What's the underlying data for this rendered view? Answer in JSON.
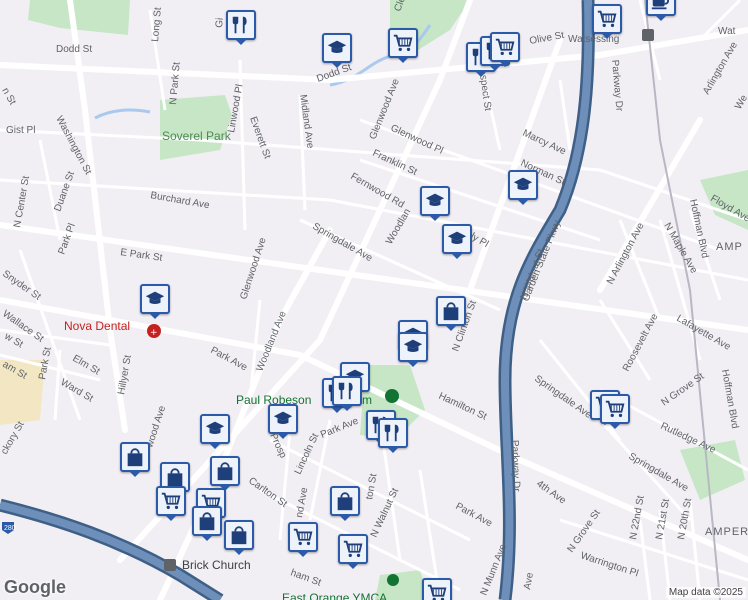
{
  "map": {
    "attribution": "Map data ©2025",
    "logo": "Google",
    "colors": {
      "land": "#f2eff4",
      "park": "#c6e6c6",
      "water": "#a9c9ee",
      "highway": "#5e7fa8",
      "highway_edge": "#3e5f86",
      "road": "#ffffff",
      "pin_border": "#2b5aa8",
      "pin_fill": "#eef3fb",
      "poi_red": "#c5221f",
      "poi_green": "#137333"
    }
  },
  "streets": {
    "dodd_st_w": "Dodd St",
    "dodd_st_e": "Dodd St",
    "long_st": "Long St",
    "n_park_st": "N Park St",
    "gist_pl": "Gist Pl",
    "washington_st": "Washington St",
    "everett_st": "Everett St",
    "linwood_pl": "Linwood Pl",
    "midland_ave": "Midland Ave",
    "glenwood_ave_n": "Glenwood Ave",
    "glenwood_ave_s": "Glenwood Ave",
    "glenwood_pl": "Glenwood Pl",
    "franklin_st": "Franklin St",
    "fernwood_rd": "Fernwood Rd",
    "woodland_n": "Woodlan",
    "burchard_ave": "Burchard Ave",
    "n_center_st": "N Center St",
    "duane_st": "Duane St",
    "park_pl": "Park Pl",
    "e_park_st": "E Park St",
    "springdale_ave_w": "Springdale Ave",
    "springdale_ave_e": "Springdale Ave",
    "snyder_st": "Snyder St",
    "wallace_st": "Wallace St",
    "w_st": "w St",
    "elm_st": "Elm St",
    "ward_st": "Ward St",
    "park_st": "Park St",
    "am_st": "am St",
    "hillyer_st": "Hillyer St",
    "woodland_ave": "Woodland Ave",
    "park_ave_w": "Park Ave",
    "park_ave_c": "Park Ave",
    "park_ave_e": "Park Ave",
    "wood_ave": "wood Ave",
    "ckory_st": "ckory St",
    "prospect_st_n": "Prospect St",
    "prosp": "Prosp",
    "lincoln_st": "Lincoln St",
    "carlton_st": "Carlton St",
    "nd_ave": "nd Ave",
    "ton_st": "ton St",
    "n_walnut_st_s": "N Walnut St",
    "n_walnut_st_n": "N Walnut St",
    "ham_st": "ham St",
    "marcy_ave": "Marcy Ave",
    "norman_st": "Norman St",
    "olive_st": "Olive St",
    "watsessing": "Watsessing",
    "wat": "Wat",
    "n_clinton_st": "N Clinton St",
    "hamilton_st": "Hamilton St",
    "garden_state_pkwy": "Garden State Pkwy",
    "parkway_dr_s": "Parkway Dr",
    "parkway_dr_n": "Parkway Dr",
    "n_arlington_ave": "N Arlington Ave",
    "n_maple_ave": "N Maple Ave",
    "hoffman_blvd_n": "Hoffman Blvd",
    "hoffman_blvd_s": "Hoffman Blvd",
    "arlington_ave": "Arlington Ave",
    "floyd_ave": "Floyd Ave",
    "lafayette_ave": "Lafayette Ave",
    "roosevelt_ave": "Roosevelt Ave",
    "springdale_ave_se": "Springdale Ave",
    "n_grove_st_n": "N Grove St",
    "n_grove_st_s": "N Grove St",
    "rutledge_ave": "Rutledge Ave",
    "fourth_ave": "4th Ave",
    "n_22nd_st": "N 22nd St",
    "n_21st_st": "N 21st St",
    "n_20th_st": "N 20th St",
    "warrington_pl": "Warrington Pl",
    "n_munn_ave": "N Munn Ave",
    "ave": "Ave",
    "ly_pl": "ly Pl",
    "ampe_e": "AMP",
    "ampe_s": "AMPER",
    "cle": "Cle",
    "gi": "Gi",
    "we": "We",
    "w_": "W",
    "n_st": "n St"
  },
  "places": {
    "soverel_park": "Soverel Park",
    "nova_dental": "Nova Dental",
    "paul_robeson": "Paul Robeson",
    "paul_robeson_tail": "m",
    "brick_church": "Brick Church",
    "east_orange_ymca": "East Orange YMCA",
    "route_280": "280"
  }
}
